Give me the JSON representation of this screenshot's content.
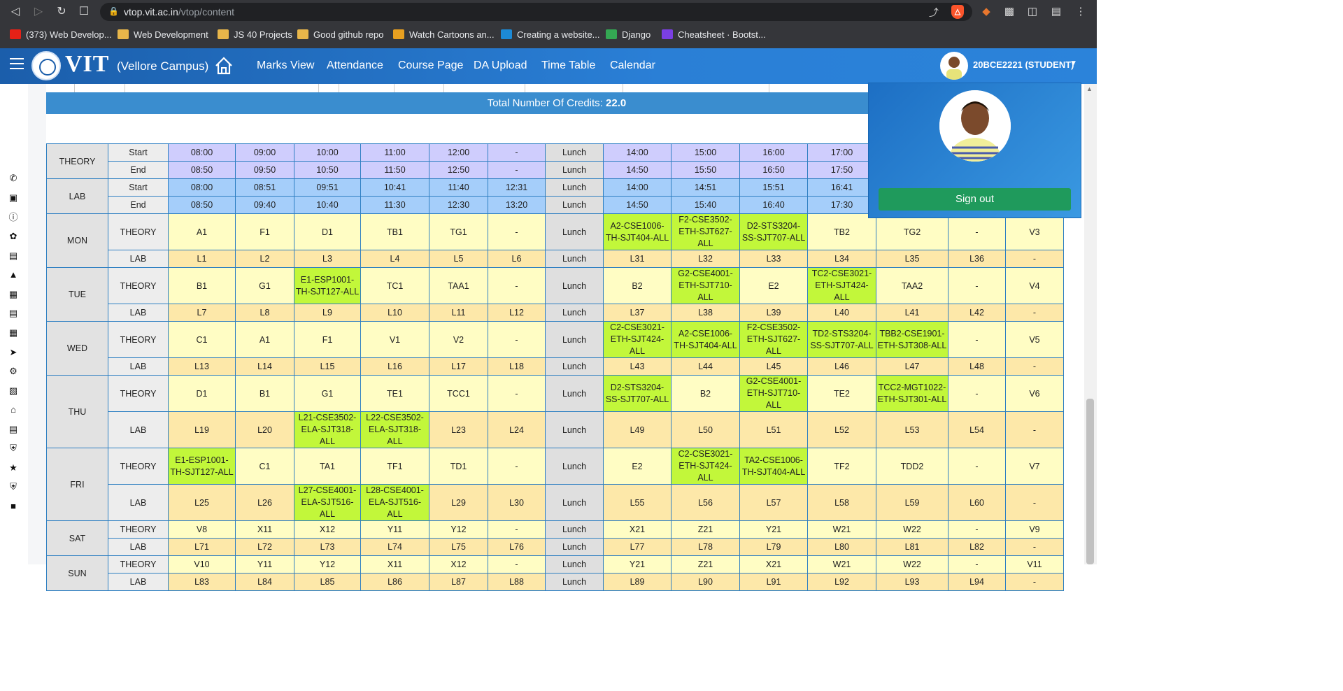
{
  "browser": {
    "url_domain": "vtop.vit.ac.in",
    "url_path": "/vtop/content",
    "bookmarks": [
      {
        "label": "(373) Web Develop...",
        "icon": "youtube-icon",
        "color": "#e62117"
      },
      {
        "label": "Web Development",
        "icon": "folder-icon",
        "color": "#e8b64a"
      },
      {
        "label": "JS 40 Projects",
        "icon": "folder-icon",
        "color": "#e8b64a"
      },
      {
        "label": "Good github repo",
        "icon": "folder-icon",
        "color": "#e8b64a"
      },
      {
        "label": "Watch Cartoons an...",
        "icon": "site-icon",
        "color": "#e8a020"
      },
      {
        "label": "Creating a website...",
        "icon": "video-icon",
        "color": "#1c8ad6"
      },
      {
        "label": "Django",
        "icon": "drive-icon",
        "color": "#34a853"
      },
      {
        "label": "Cheatsheet · Bootst...",
        "icon": "bootstrap-icon",
        "color": "#7b3fe4"
      }
    ]
  },
  "header": {
    "logo": "VIT",
    "campus": "(Vellore Campus)",
    "nav": [
      "Marks View",
      "Attendance",
      "Course Page",
      "DA Upload",
      "Time Table",
      "Calendar"
    ],
    "user": "20BCE2221 (STUDENT)"
  },
  "profile_popup": {
    "signout_label": "Sign out"
  },
  "credits": {
    "label": "Total Number Of Credits:",
    "value": "22.0"
  },
  "timetable": {
    "headers": [
      {
        "group": "THEORY",
        "label": "Start",
        "cells": [
          "08:00",
          "09:00",
          "10:00",
          "11:00",
          "12:00",
          "-",
          "Lunch",
          "14:00",
          "15:00",
          "16:00",
          "17:00",
          "",
          "",
          ""
        ]
      },
      {
        "group": "THEORY",
        "label": "End",
        "cells": [
          "08:50",
          "09:50",
          "10:50",
          "11:50",
          "12:50",
          "-",
          "Lunch",
          "14:50",
          "15:50",
          "16:50",
          "17:50",
          "",
          "",
          ""
        ]
      },
      {
        "group": "LAB",
        "label": "Start",
        "cells": [
          "08:00",
          "08:51",
          "09:51",
          "10:41",
          "11:40",
          "12:31",
          "Lunch",
          "14:00",
          "14:51",
          "15:51",
          "16:41",
          "",
          "",
          ""
        ]
      },
      {
        "group": "LAB",
        "label": "End",
        "cells": [
          "08:50",
          "09:40",
          "10:40",
          "11:30",
          "12:30",
          "13:20",
          "Lunch",
          "14:50",
          "15:40",
          "16:40",
          "17:30",
          "",
          "",
          ""
        ]
      }
    ],
    "days": [
      {
        "day": "MON",
        "theory": [
          "A1",
          "F1",
          "D1",
          "TB1",
          "TG1",
          "-",
          "Lunch",
          "A2-CSE1006-TH-SJT404-ALL",
          "F2-CSE3502-ETH-SJT627-ALL",
          "D2-STS3204-SS-SJT707-ALL",
          "TB2",
          "TG2",
          "-",
          "V3"
        ],
        "lab": [
          "L1",
          "L2",
          "L3",
          "L4",
          "L5",
          "L6",
          "Lunch",
          "L31",
          "L32",
          "L33",
          "L34",
          "L35",
          "L36",
          "-"
        ]
      },
      {
        "day": "TUE",
        "theory": [
          "B1",
          "G1",
          "E1-ESP1001-TH-SJT127-ALL",
          "TC1",
          "TAA1",
          "-",
          "Lunch",
          "B2",
          "G2-CSE4001-ETH-SJT710-ALL",
          "E2",
          "TC2-CSE3021-ETH-SJT424-ALL",
          "TAA2",
          "-",
          "V4"
        ],
        "lab": [
          "L7",
          "L8",
          "L9",
          "L10",
          "L11",
          "L12",
          "Lunch",
          "L37",
          "L38",
          "L39",
          "L40",
          "L41",
          "L42",
          "-"
        ]
      },
      {
        "day": "WED",
        "theory": [
          "C1",
          "A1",
          "F1",
          "V1",
          "V2",
          "-",
          "Lunch",
          "C2-CSE3021-ETH-SJT424-ALL",
          "A2-CSE1006-TH-SJT404-ALL",
          "F2-CSE3502-ETH-SJT627-ALL",
          "TD2-STS3204-SS-SJT707-ALL",
          "TBB2-CSE1901-ETH-SJT308-ALL",
          "-",
          "V5"
        ],
        "lab": [
          "L13",
          "L14",
          "L15",
          "L16",
          "L17",
          "L18",
          "Lunch",
          "L43",
          "L44",
          "L45",
          "L46",
          "L47",
          "L48",
          "-"
        ]
      },
      {
        "day": "THU",
        "theory": [
          "D1",
          "B1",
          "G1",
          "TE1",
          "TCC1",
          "-",
          "Lunch",
          "D2-STS3204-SS-SJT707-ALL",
          "B2",
          "G2-CSE4001-ETH-SJT710-ALL",
          "TE2",
          "TCC2-MGT1022-ETH-SJT301-ALL",
          "-",
          "V6"
        ],
        "lab": [
          "L19",
          "L20",
          "L21-CSE3502-ELA-SJT318-ALL",
          "L22-CSE3502-ELA-SJT318-ALL",
          "L23",
          "L24",
          "Lunch",
          "L49",
          "L50",
          "L51",
          "L52",
          "L53",
          "L54",
          "-"
        ]
      },
      {
        "day": "FRI",
        "theory": [
          "E1-ESP1001-TH-SJT127-ALL",
          "C1",
          "TA1",
          "TF1",
          "TD1",
          "-",
          "Lunch",
          "E2",
          "C2-CSE3021-ETH-SJT424-ALL",
          "TA2-CSE1006-TH-SJT404-ALL",
          "TF2",
          "TDD2",
          "-",
          "V7"
        ],
        "lab": [
          "L25",
          "L26",
          "L27-CSE4001-ELA-SJT516-ALL",
          "L28-CSE4001-ELA-SJT516-ALL",
          "L29",
          "L30",
          "Lunch",
          "L55",
          "L56",
          "L57",
          "L58",
          "L59",
          "L60",
          "-"
        ]
      },
      {
        "day": "SAT",
        "theory": [
          "V8",
          "X11",
          "X12",
          "Y11",
          "Y12",
          "-",
          "Lunch",
          "X21",
          "Z21",
          "Y21",
          "W21",
          "W22",
          "-",
          "V9"
        ],
        "lab": [
          "L71",
          "L72",
          "L73",
          "L74",
          "L75",
          "L76",
          "Lunch",
          "L77",
          "L78",
          "L79",
          "L80",
          "L81",
          "L82",
          "-"
        ]
      },
      {
        "day": "SUN",
        "theory": [
          "V10",
          "Y11",
          "Y12",
          "X11",
          "X12",
          "-",
          "Lunch",
          "Y21",
          "Z21",
          "X21",
          "W21",
          "W22",
          "-",
          "V11"
        ],
        "lab": [
          "L83",
          "L84",
          "L85",
          "L86",
          "L87",
          "L88",
          "Lunch",
          "L89",
          "L90",
          "L91",
          "L92",
          "L93",
          "L94",
          "-"
        ]
      }
    ]
  },
  "colors": {
    "theory_header": "#cfcdfd",
    "lab_header": "#a5cefa",
    "theory_cell": "#fffdc4",
    "lab_cell": "#fde8a9",
    "registered": "#c2f73a",
    "header_bar": "#1b5eab"
  }
}
